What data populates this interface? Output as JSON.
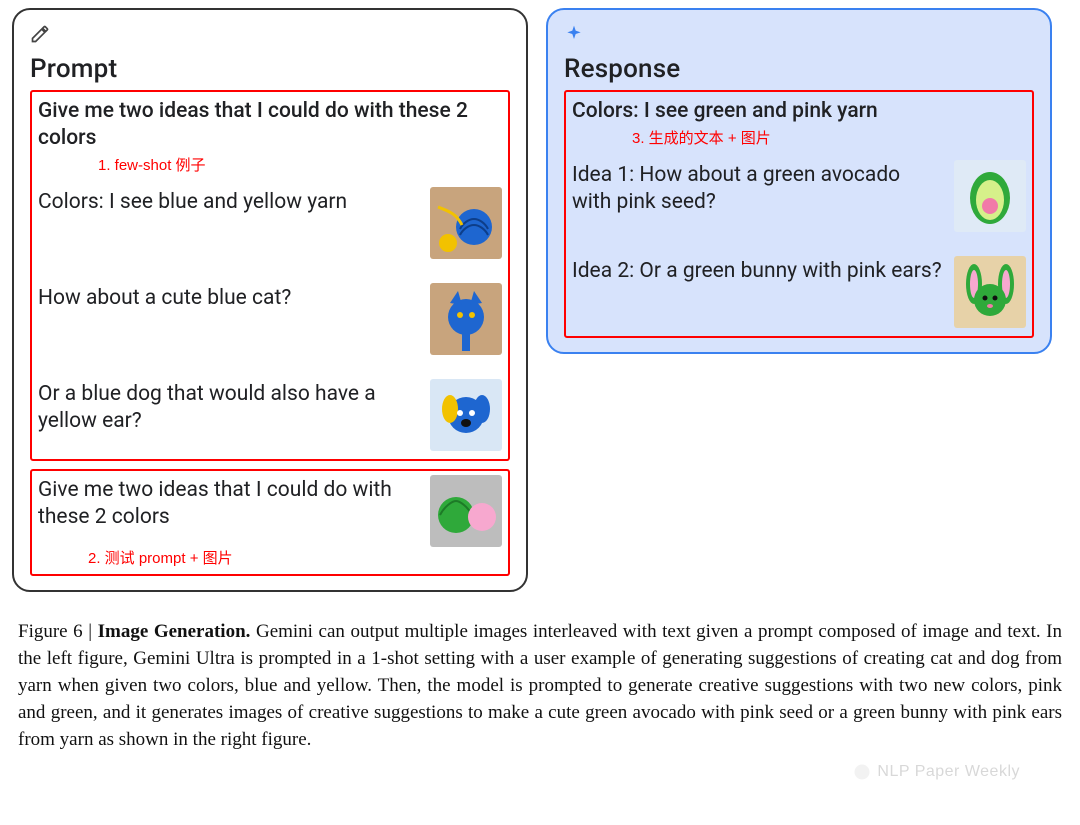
{
  "prompt_panel": {
    "heading": "Prompt",
    "box1": {
      "annotation": "1. few-shot 例子",
      "lines": [
        "Give me two ideas that I could do with these 2 colors",
        "Colors: I see blue and yellow yarn",
        "How about a cute blue cat?",
        "Or a blue dog that would also have a yellow ear?"
      ]
    },
    "box2": {
      "annotation": "2. 测试 prompt + 图片",
      "line": "Give me two ideas that I could do with these 2 colors"
    }
  },
  "response_panel": {
    "heading": "Response",
    "box": {
      "annotation": "3. 生成的文本 + 图片",
      "lines": [
        "Colors: I see green and pink yarn",
        "Idea 1: How about a green avocado with pink seed?",
        "Idea 2: Or a green bunny with pink ears?"
      ]
    }
  },
  "caption": {
    "label": "Figure 6 | ",
    "title": "Image Generation.",
    "body": " Gemini can output multiple images interleaved with text given a prompt composed of image and text. In the left figure, Gemini Ultra is prompted in a 1-shot setting with a user example of generating suggestions of creating cat and dog from yarn when given two colors, blue and yellow. Then, the model is prompted to generate creative suggestions with two new colors, pink and green, and it generates images of creative suggestions to make a cute green avocado with pink seed or a green bunny with pink ears from yarn as shown in the right figure."
  },
  "watermark": "NLP Paper Weekly"
}
